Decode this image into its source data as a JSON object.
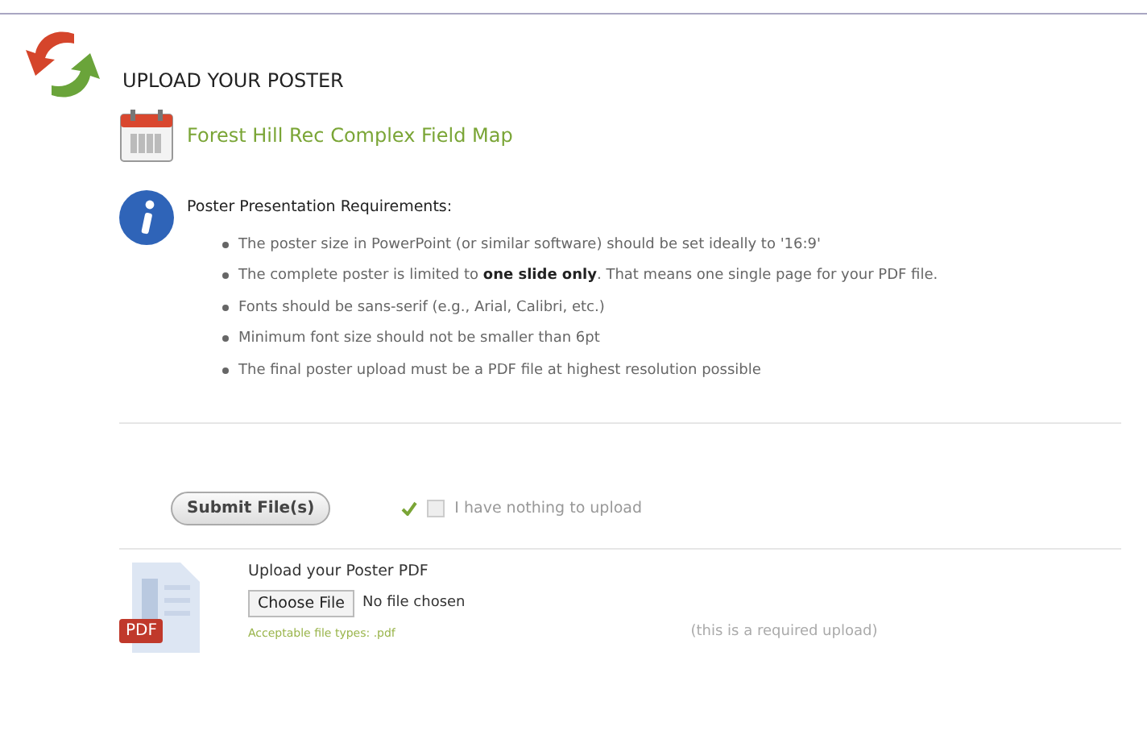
{
  "title": "UPLOAD YOUR POSTER",
  "event_link": "Forest Hill Rec Complex Field Map",
  "requirements": {
    "heading": "Poster Presentation Requirements:",
    "items": [
      "The poster size in PowerPoint (or similar software) should be set ideally to '16:9'",
      "The complete poster is limited to **one slide only**. That means one single page for your PDF file.",
      "Fonts should be sans-serif (e.g., Arial, Calibri, etc.)",
      "Minimum font size should not be smaller than 6pt",
      "The final poster upload must be a PDF file at highest resolution possible"
    ]
  },
  "submit_button": "Submit File(s)",
  "nothing_to_upload": {
    "label": "I have nothing to upload",
    "checked": false
  },
  "upload": {
    "badge": "PDF",
    "label": "Upload your Poster PDF",
    "choose_button": "Choose File",
    "file_status": "No file chosen",
    "file_types": "Acceptable file types: .pdf",
    "required_note": "(this is a required upload)"
  }
}
